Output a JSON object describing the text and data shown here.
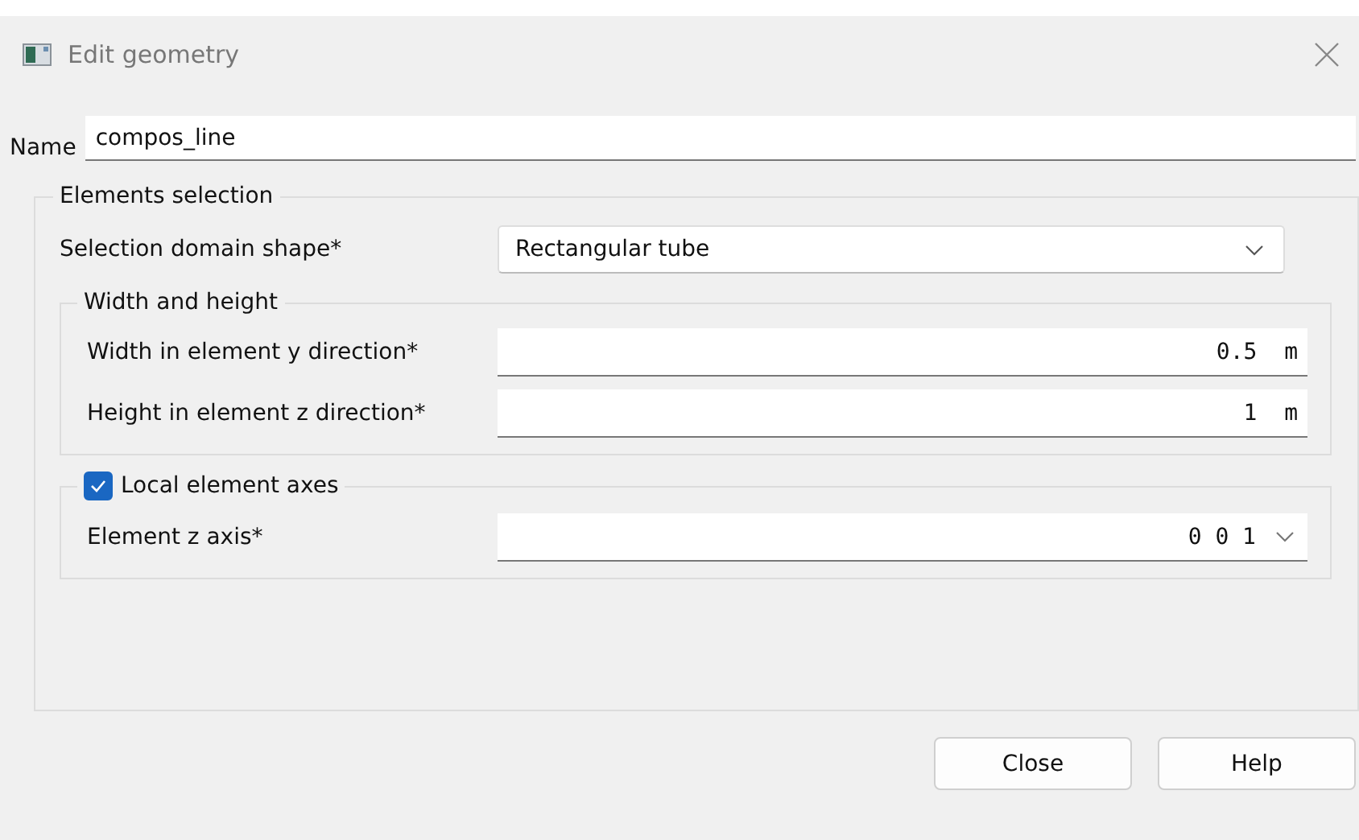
{
  "window": {
    "title": "Edit geometry"
  },
  "name": {
    "label": "Name",
    "value": "compos_line"
  },
  "selection": {
    "title": "Elements selection",
    "shape": {
      "label": "Selection domain shape*",
      "value": "Rectangular tube"
    },
    "size_group": {
      "title": "Width and height",
      "fields": [
        {
          "label": "Width in element y direction*",
          "value": "0.5",
          "unit": "m"
        },
        {
          "label": "Height in element z direction*",
          "value": "1",
          "unit": "m"
        }
      ]
    },
    "axes_group": {
      "title": "Local element axes",
      "checked": true,
      "field": {
        "label": "Element z axis*",
        "value": "0 0 1"
      }
    }
  },
  "buttons": [
    "Close",
    "Help"
  ]
}
